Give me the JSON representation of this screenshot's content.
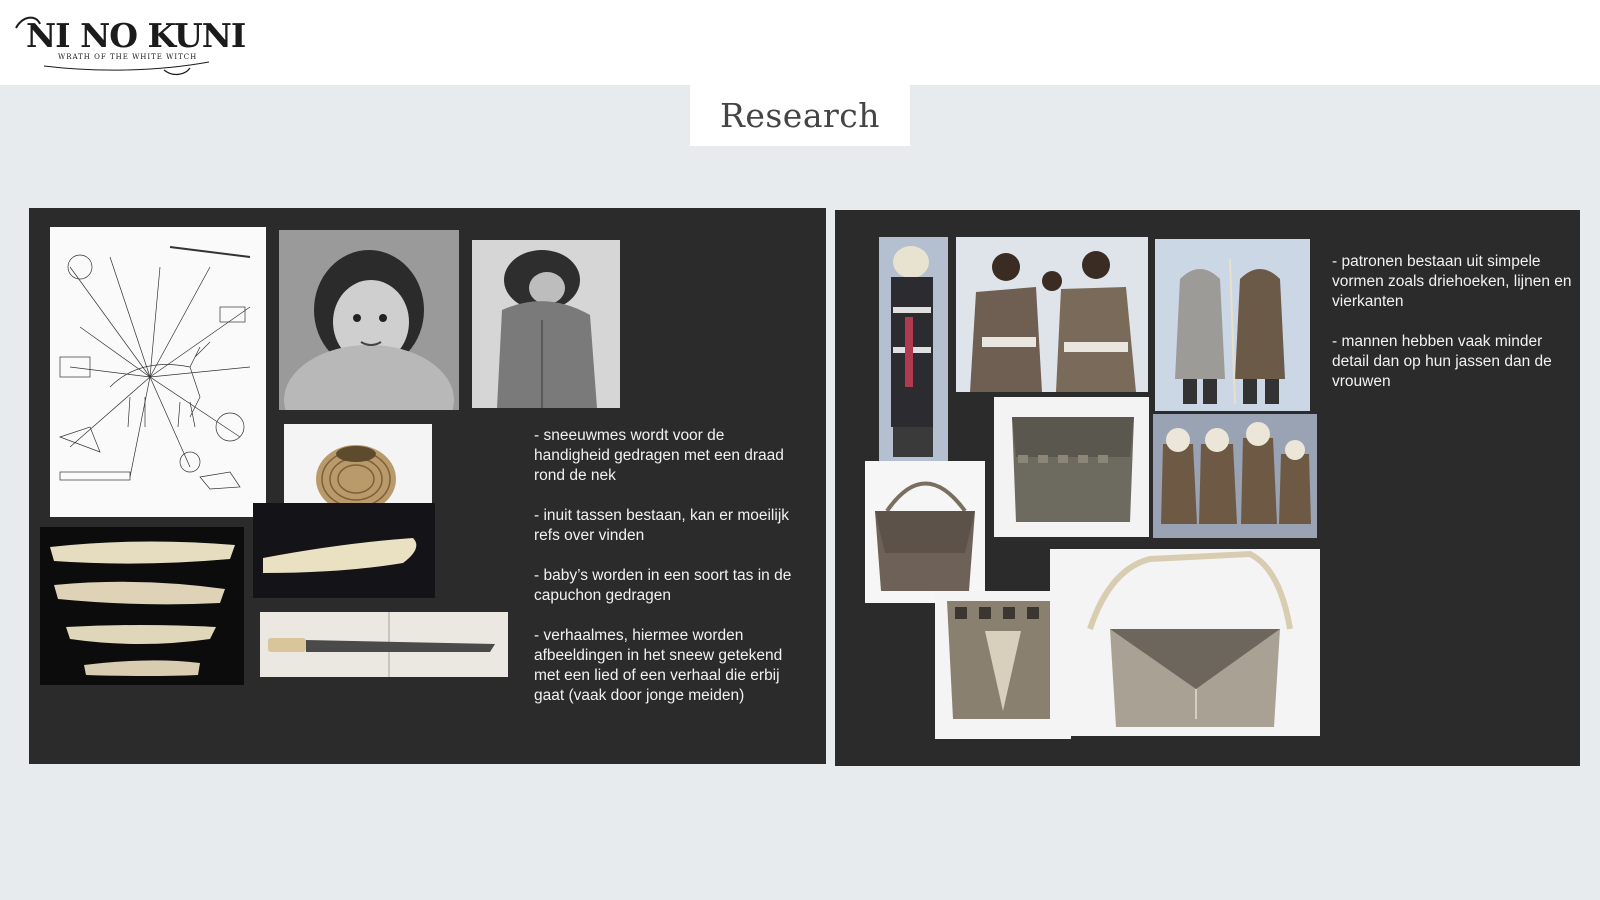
{
  "header": {
    "logo_text": "NI NO KUNI",
    "logo_subtitle": "WRATH OF THE WHITE WITCH",
    "page_title": "Research"
  },
  "left_panel": {
    "notes": [
      "- sneeuwmes wordt voor de handigheid gedragen met een draad rond de nek",
      "- inuit tassen bestaan, kan er moeilijk refs over vinden",
      "- baby’s worden in een soort tas in de capuchon gedragen",
      "- verhaalmes, hiermee worden afbeeldingen in het sneew getekend met een lied of een verhaal die erbij gaat (vaak door jonge meiden)"
    ]
  },
  "right_panel": {
    "notes": [
      "- patronen bestaan uit simpele vormen zoals driehoeken, lijnen en vierkanten",
      "- mannen hebben vaak minder detail dan op hun jassen dan de vrouwen"
    ]
  },
  "colors": {
    "background": "#e8ebee",
    "panel": "#2b2b2c",
    "text_light": "#f2f2f2"
  }
}
